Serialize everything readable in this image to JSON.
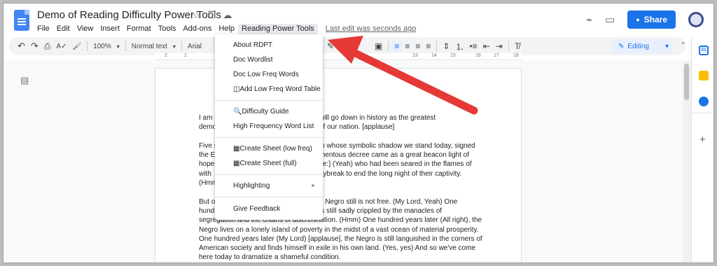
{
  "header": {
    "title": "Demo of Reading Difficulty Power Tools",
    "star_icon": "☆",
    "folder_icon": "❐",
    "cloud_icon": "☁",
    "share_label": "Share",
    "lock_icon": "🔒",
    "trend_icon": "⌁",
    "comment_icon": "▭"
  },
  "menubar": {
    "items": [
      "File",
      "Edit",
      "View",
      "Insert",
      "Format",
      "Tools",
      "Add-ons",
      "Help",
      "Reading Power Tools"
    ],
    "last_edit": "Last edit was seconds ago"
  },
  "toolbar": {
    "undo": "↶",
    "redo": "↷",
    "print": "⎙",
    "spell": "A✓",
    "paint": "🖌",
    "zoom": "100%",
    "style": "Normal text",
    "font": "Arial",
    "pen": "✎",
    "image": "▣",
    "align_left": "≡",
    "align_center": "≡",
    "align_right": "≡",
    "align_justify": "≡",
    "line_spacing": "⇕",
    "numbered_list": "⒈",
    "bullet_list": "•≡",
    "indent_less": "⇤",
    "indent_more": "⇥",
    "clear_format": "T̸",
    "editing": "Editing",
    "caret": "▾",
    "collapse": "⌃"
  },
  "ruler": {
    "ticks": [
      "2",
      "1",
      "13",
      "14",
      "15",
      "16",
      "17",
      "18"
    ]
  },
  "menu": {
    "items": [
      {
        "label": "About RDPT"
      },
      {
        "label": "Doc Wordlist"
      },
      {
        "label": "Doc Low Freq Words"
      },
      {
        "label": "◫Add Low Freq Word Table"
      },
      {
        "label": "🔍Difficulty Guide"
      },
      {
        "label": "High Frequency Word List"
      },
      {
        "label": "▦Create Sheet (low freq)"
      },
      {
        "label": "▦Create Sheet (full)"
      },
      {
        "label": "Highlighting",
        "arrow": "►"
      },
      {
        "label": "Give Feedback"
      }
    ]
  },
  "document": {
    "p1": [
      "I am h",
      "will go down in history as the greatest",
      "demo",
      "of our nation. [applause]"
    ],
    "p2": [
      "Five s",
      "in whose symbolic shadow we stand today, signed",
      "the E",
      "mentous decree came as a great beacon light of",
      "hope",
      "ce:] (Yeah) who had been seared in the flames of",
      "with",
      "aybreak to end the long night of their captivity.",
      "(Hmm"
    ],
    "p3": [
      "But o",
      "e Negro still is not free. (My Lord, Yeah) One",
      "hundr",
      "is still sadly crippled by the manacles of",
      "segregation and the chains of discrimination. (Hmm) One hundred years later (All right), the",
      "Negro lives on a lonely island of poverty in the midst of a vast ocean of material prosperity.",
      "One hundred years later (My Lord) [applause], the Negro is still languished in the corners of",
      "American society and finds himself in exile in his own land. (Yes, yes) And so we've come",
      "here today to dramatize a shameful condition."
    ]
  },
  "side_panel": {
    "calendar_icon": "31",
    "plus_icon": "+"
  },
  "colors": {
    "accent": "#1a73e8",
    "arrow": "#e53935",
    "keep": "#fbbc04",
    "tasks": "#1a73e8"
  }
}
